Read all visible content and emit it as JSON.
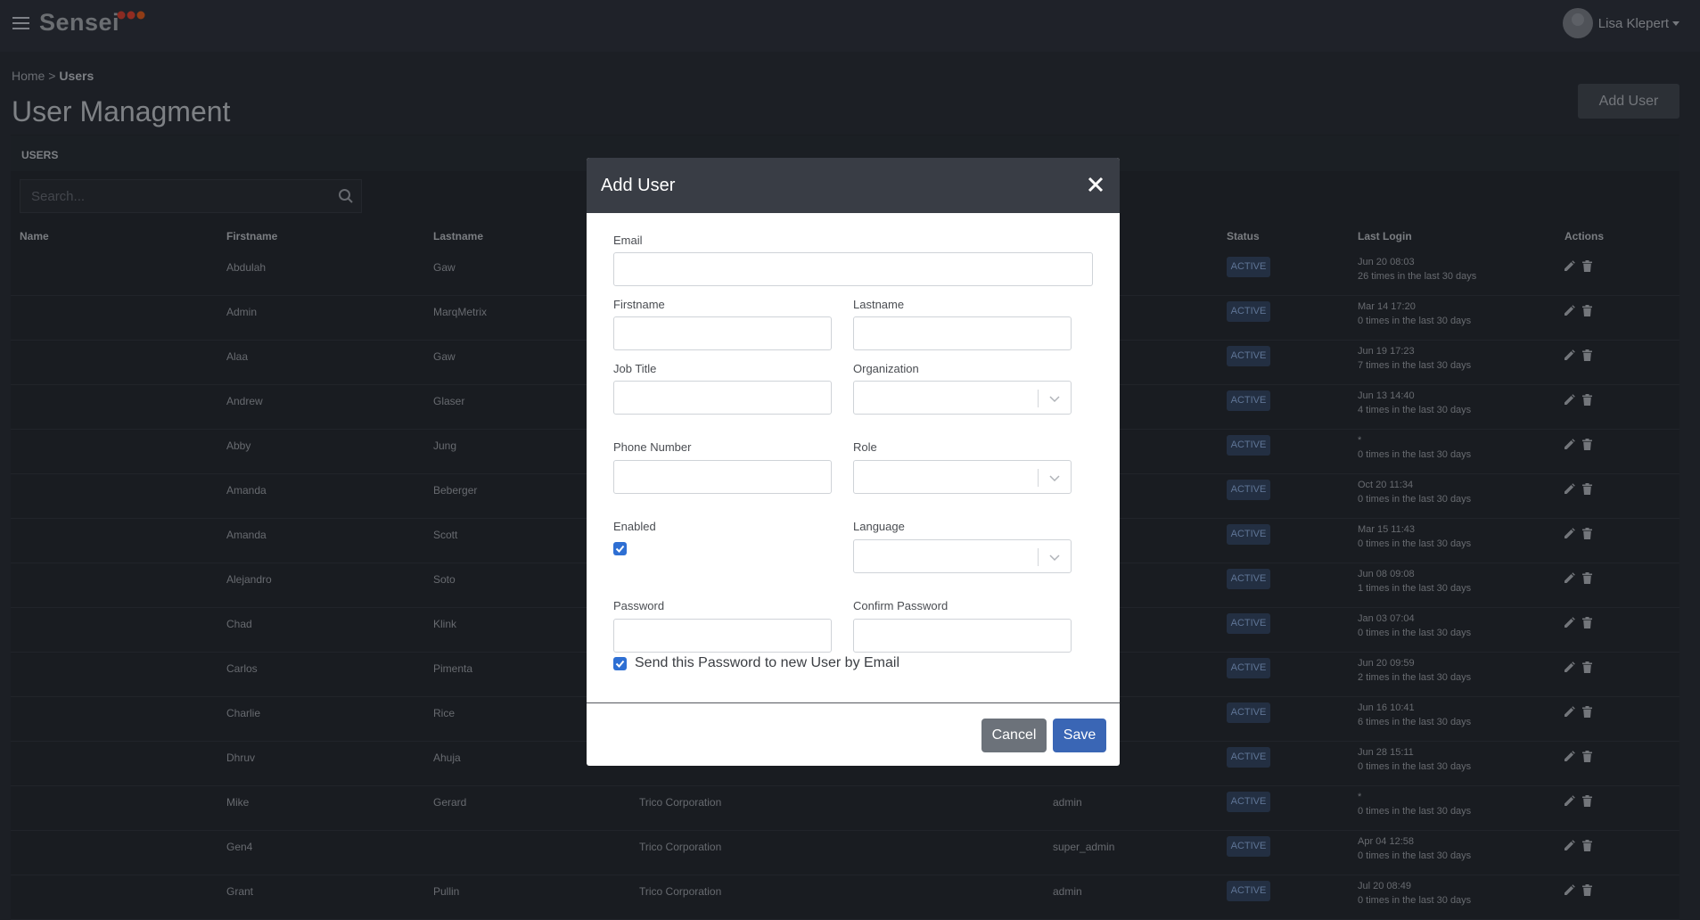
{
  "app": {
    "logo": "Sensei",
    "user_name": "Lisa Klepert"
  },
  "breadcrumb": {
    "home": "Home",
    "separator": " > ",
    "current": "Users"
  },
  "page": {
    "title": "User Managment",
    "add_user_label": "Add User"
  },
  "users_panel": {
    "label": "USERS",
    "search_placeholder": "Search..."
  },
  "table": {
    "headers": {
      "name": "Name",
      "firstname": "Firstname",
      "lastname": "Lastname",
      "status": "Status",
      "last_login": "Last Login",
      "actions": "Actions"
    },
    "rows": [
      {
        "firstname": "Abdulah",
        "lastname": "Gaw",
        "organization": "",
        "role": "",
        "status": "ACTIVE",
        "login": "Jun 20 08:03",
        "login_count": "26 times in the last 30 days"
      },
      {
        "firstname": "Admin",
        "lastname": "MarqMetrix",
        "organization": "",
        "role": "",
        "status": "ACTIVE",
        "login": "Mar 14 17:20",
        "login_count": "0 times in the last 30 days"
      },
      {
        "firstname": "Alaa",
        "lastname": "Gaw",
        "organization": "",
        "role": "",
        "status": "ACTIVE",
        "login": "Jun 19 17:23",
        "login_count": "7 times in the last 30 days"
      },
      {
        "firstname": "Andrew",
        "lastname": "Glaser",
        "organization": "",
        "role": "",
        "status": "ACTIVE",
        "login": "Jun 13 14:40",
        "login_count": "4 times in the last 30 days"
      },
      {
        "firstname": "Abby",
        "lastname": "Jung",
        "organization": "",
        "role": "",
        "status": "ACTIVE",
        "login": "*",
        "login_count": "0 times in the last 30 days"
      },
      {
        "firstname": "Amanda",
        "lastname": "Beberger",
        "organization": "",
        "role": "",
        "status": "ACTIVE",
        "login": "Oct 20 11:34",
        "login_count": "0 times in the last 30 days"
      },
      {
        "firstname": "Amanda",
        "lastname": "Scott",
        "organization": "",
        "role": "",
        "status": "ACTIVE",
        "login": "Mar 15 11:43",
        "login_count": "0 times in the last 30 days"
      },
      {
        "firstname": "Alejandro",
        "lastname": "Soto",
        "organization": "",
        "role": "",
        "status": "ACTIVE",
        "login": "Jun 08 09:08",
        "login_count": "1 times in the last 30 days"
      },
      {
        "firstname": "Chad",
        "lastname": "Klink",
        "organization": "",
        "role": "",
        "status": "ACTIVE",
        "login": "Jan 03 07:04",
        "login_count": "0 times in the last 30 days"
      },
      {
        "firstname": "Carlos",
        "lastname": "Pimenta",
        "organization": "",
        "role": "",
        "status": "ACTIVE",
        "login": "Jun 20 09:59",
        "login_count": "2 times in the last 30 days"
      },
      {
        "firstname": "Charlie",
        "lastname": "Rice",
        "organization": "",
        "role": "",
        "status": "ACTIVE",
        "login": "Jun 16 10:41",
        "login_count": "6 times in the last 30 days"
      },
      {
        "firstname": "Dhruv",
        "lastname": "Ahuja",
        "organization": "",
        "role": "",
        "status": "ACTIVE",
        "login": "Jun 28 15:11",
        "login_count": "0 times in the last 30 days"
      },
      {
        "firstname": "Mike",
        "lastname": "Gerard",
        "organization": "Trico Corporation",
        "role": "admin",
        "status": "ACTIVE",
        "login": "*",
        "login_count": "0 times in the last 30 days"
      },
      {
        "firstname": "Gen4",
        "lastname": "",
        "organization": "Trico Corporation",
        "role": "super_admin",
        "status": "ACTIVE",
        "login": "Apr 04 12:58",
        "login_count": "0 times in the last 30 days"
      },
      {
        "firstname": "Grant",
        "lastname": "Pullin",
        "organization": "Trico Corporation",
        "role": "admin",
        "status": "ACTIVE",
        "login": "Jul 20 08:49",
        "login_count": "0 times in the last 30 days"
      }
    ]
  },
  "modal": {
    "title": "Add User",
    "fields": {
      "email": {
        "label": "Email",
        "value": ""
      },
      "firstname": {
        "label": "Firstname",
        "value": ""
      },
      "lastname": {
        "label": "Lastname",
        "value": ""
      },
      "job_title": {
        "label": "Job Title",
        "value": ""
      },
      "organization": {
        "label": "Organization",
        "value": ""
      },
      "phone": {
        "label": "Phone Number",
        "value": ""
      },
      "role": {
        "label": "Role",
        "value": ""
      },
      "enabled": {
        "label": "Enabled",
        "checked": true
      },
      "language": {
        "label": "Language",
        "value": ""
      },
      "password": {
        "label": "Password",
        "value": ""
      },
      "confirm_password": {
        "label": "Confirm Password",
        "value": ""
      }
    },
    "send_email_label": "Send this Password to new User by Email",
    "send_email_checked": true,
    "cancel_label": "Cancel",
    "save_label": "Save"
  },
  "colors": {
    "background": "#262a32",
    "topbar": "#2a2e37",
    "modal_header": "#393d45",
    "save_button": "#3a66b5",
    "cancel_button": "#6c727a",
    "checkbox": "#2e6fd3",
    "status_badge": "#2f3f58",
    "logo_dots": [
      "#c0392b",
      "#e74c3c",
      "#d35400"
    ]
  },
  "icons": [
    "menu-icon",
    "search-icon",
    "edit-icon",
    "trash-icon",
    "close-icon",
    "chevron-down-icon",
    "check-icon"
  ]
}
